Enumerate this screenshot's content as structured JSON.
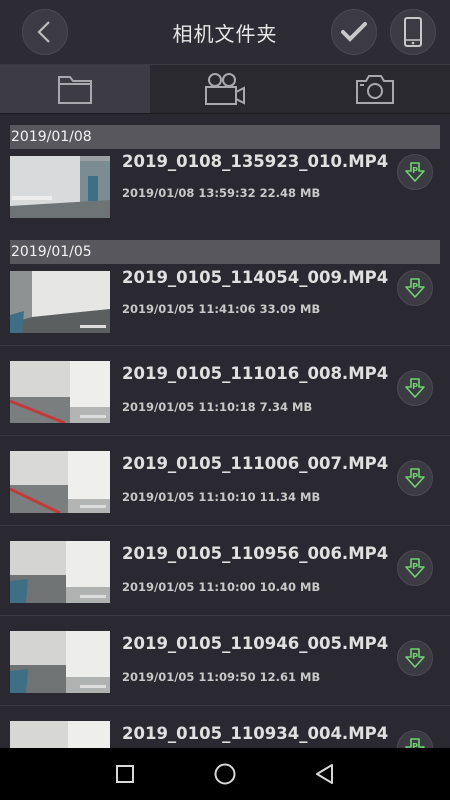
{
  "header": {
    "title": "相机文件夹",
    "back_icon": "chevron-left-icon",
    "check_icon": "check-icon",
    "phone_icon": "phone-icon"
  },
  "tabs": [
    {
      "icon": "folder-icon",
      "active": true
    },
    {
      "icon": "video-camera-icon",
      "active": false
    },
    {
      "icon": "photo-camera-icon",
      "active": false
    }
  ],
  "groups": [
    {
      "date": "2019/01/08",
      "files": [
        {
          "name": "2019_0108_135923_010.MP4",
          "meta": "2019/01/08 13:59:32  22.48 MB"
        }
      ]
    },
    {
      "date": "2019/01/05",
      "files": [
        {
          "name": "2019_0105_114054_009.MP4",
          "meta": "2019/01/05 11:41:06  33.09 MB"
        },
        {
          "name": "2019_0105_111016_008.MP4",
          "meta": "2019/01/05 11:10:18  7.34 MB"
        },
        {
          "name": "2019_0105_111006_007.MP4",
          "meta": "2019/01/05 11:10:10  11.34 MB"
        },
        {
          "name": "2019_0105_110956_006.MP4",
          "meta": "2019/01/05 11:10:00  10.40 MB"
        },
        {
          "name": "2019_0105_110946_005.MP4",
          "meta": "2019/01/05 11:09:50  12.61 MB"
        },
        {
          "name": "2019_0105_110934_004.MP4",
          "meta": ""
        }
      ]
    }
  ],
  "navbar": {
    "recent_icon": "square-icon",
    "home_icon": "circle-icon",
    "back_icon": "triangle-back-icon"
  },
  "colors": {
    "background": "#2a2830",
    "header_bar": "#59575e",
    "download_accent": "#6fd36f"
  }
}
